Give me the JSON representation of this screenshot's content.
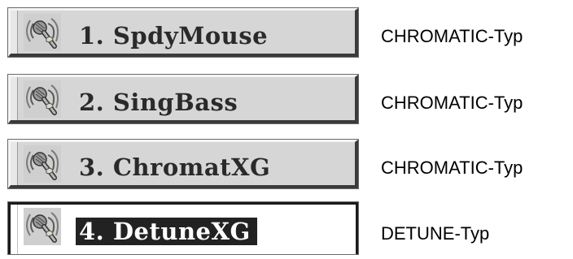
{
  "items": [
    {
      "label": "1. SpdyMouse",
      "type": "CHROMATIC-Typ",
      "icon": "mic-speaker-icon"
    },
    {
      "label": "2. SingBass",
      "type": "CHROMATIC-Typ",
      "icon": "mic-speaker-icon"
    },
    {
      "label": "3. ChromatXG",
      "type": "CHROMATIC-Typ",
      "icon": "mic-speaker-icon"
    },
    {
      "label": "4. DetuneXG",
      "type": "DETUNE-Typ",
      "icon": "mic-speaker-icon"
    }
  ],
  "selected_index": 3,
  "colors": {
    "panel_face": "#d6d6d6",
    "selected_face": "#ffffff",
    "selected_label_bg": "#222222"
  }
}
